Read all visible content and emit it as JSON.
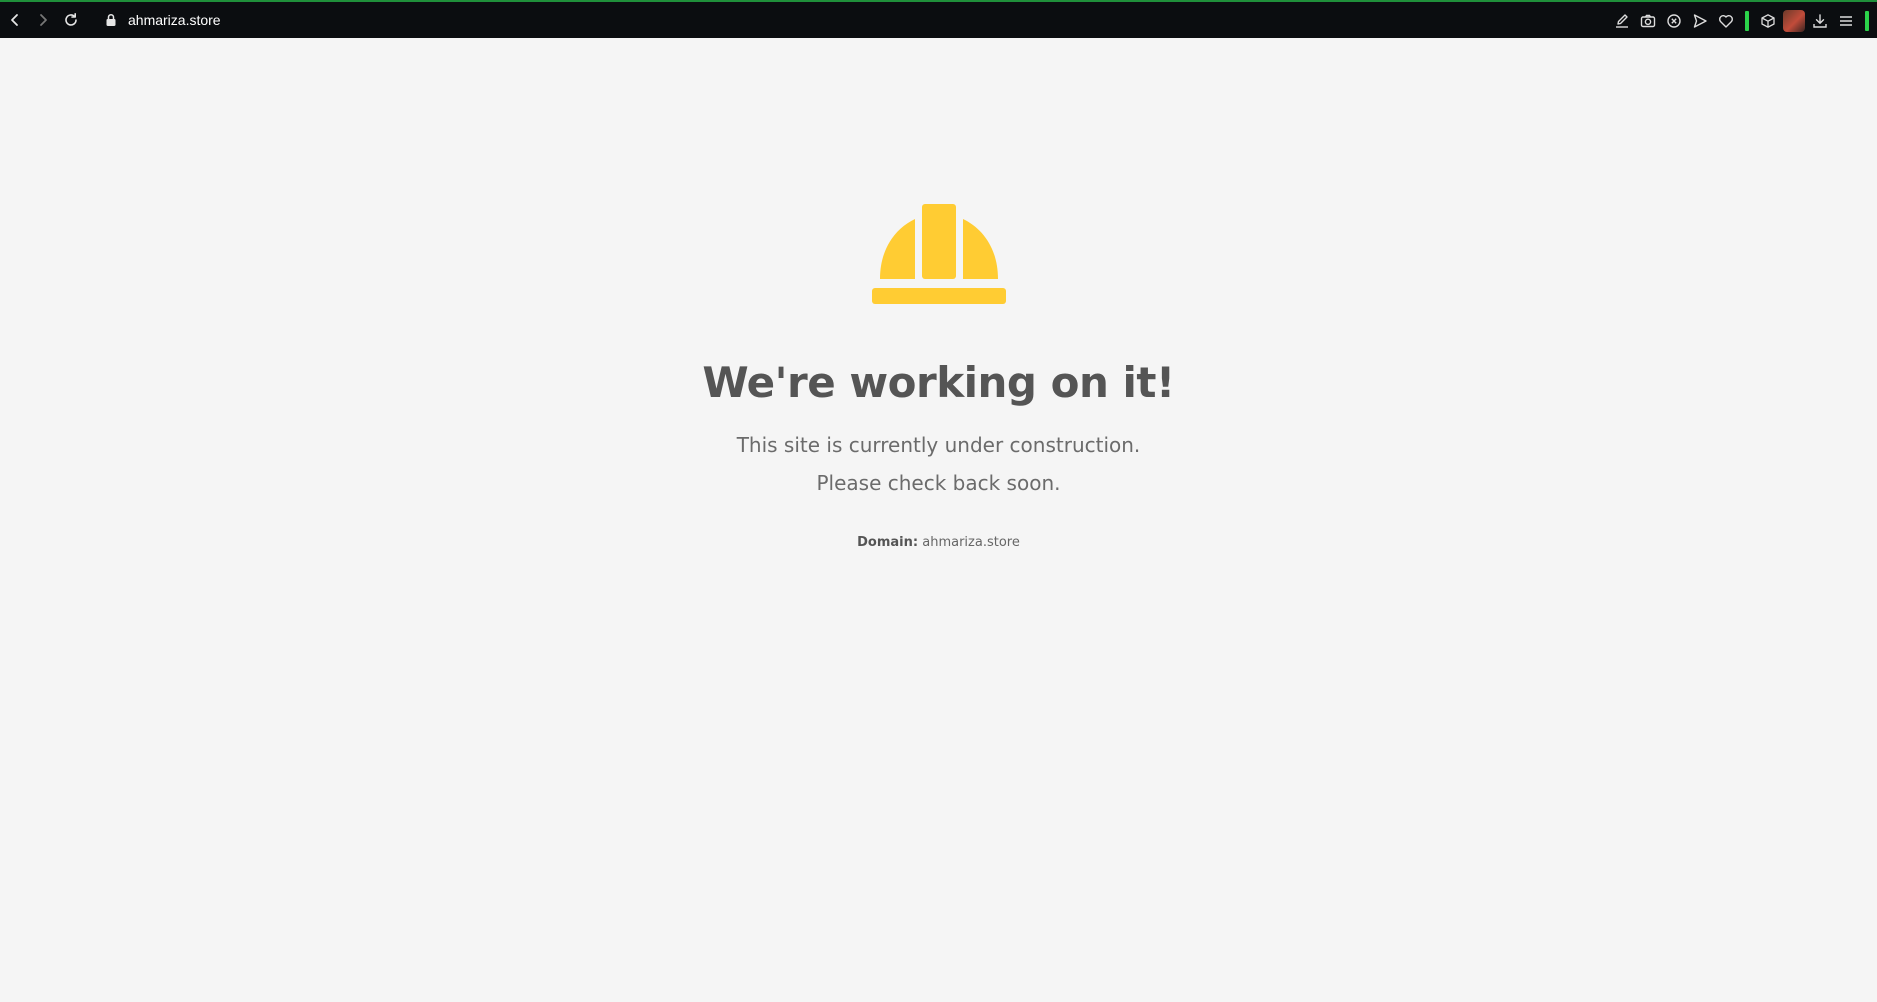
{
  "browser": {
    "url": "ahmariza.store",
    "toolbar_icons": [
      "edit-icon",
      "camera-icon",
      "close-circle-icon",
      "send-icon",
      "heart-icon",
      "cube-icon",
      "avatar",
      "download-icon",
      "menu-icon"
    ],
    "accent_color": "#2bd34a"
  },
  "page": {
    "title": "We're working on it!",
    "message_line1": "This site is currently under construction.",
    "message_line2": "Please check back soon.",
    "domain_label": "Domain:",
    "domain_value": "ahmariza.store",
    "helmet_color": "#ffcc33"
  }
}
